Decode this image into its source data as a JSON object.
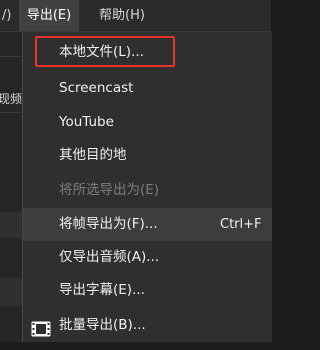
{
  "menubar": {
    "partial_item": "/)",
    "export_menu": "导出(E)",
    "help_menu": "帮助(H)"
  },
  "background": {
    "snippet": "现频"
  },
  "export_menu_items": [
    {
      "label": "本地文件(L)...",
      "shortcut": "",
      "enabled": true
    },
    {
      "label": "Screencast",
      "shortcut": "",
      "enabled": true
    },
    {
      "label": "YouTube",
      "shortcut": "",
      "enabled": true
    },
    {
      "label": "其他目的地",
      "shortcut": "",
      "enabled": true
    },
    {
      "label": "将所选导出为(E)",
      "shortcut": "",
      "enabled": false
    },
    {
      "label": "将帧导出为(F)...",
      "shortcut": "Ctrl+F",
      "enabled": true
    },
    {
      "label": "仅导出音频(A)...",
      "shortcut": "",
      "enabled": true
    },
    {
      "label": "导出字幕(E)...",
      "shortcut": "",
      "enabled": true
    },
    {
      "label": "批量导出(B)...",
      "shortcut": "",
      "enabled": true,
      "icon": "film-strip-icon"
    }
  ],
  "colors": {
    "highlight_border": "#e8342a",
    "disabled_text": "#7c7c7c",
    "menu_background": "#2f2f2f"
  }
}
